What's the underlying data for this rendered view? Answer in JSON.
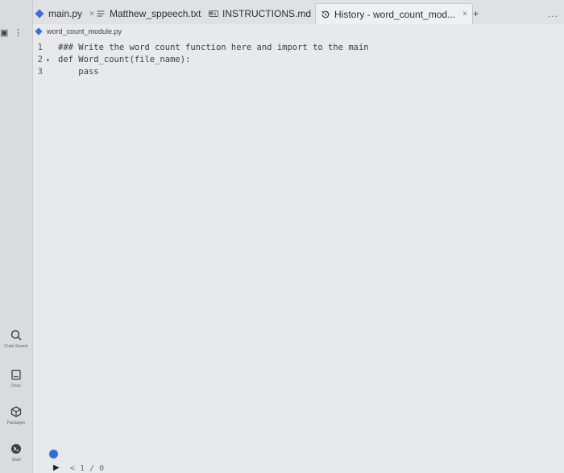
{
  "tabs": [
    {
      "label": "main.py",
      "close": "×",
      "icon": "python-icon"
    },
    {
      "label": "Matthew_sppeech.txt",
      "close": "×",
      "icon": "text-file-icon"
    },
    {
      "label": "INSTRUCTIONS.md",
      "close": "×",
      "icon": "markdown-icon"
    },
    {
      "label": "History - word_count_mod...",
      "close": "×",
      "icon": "history-icon",
      "active": true
    }
  ],
  "tab_add": "+",
  "tab_more": "...",
  "editor": {
    "file_name": "word_count_module.py",
    "lines": [
      {
        "num": "1",
        "fold": "",
        "text": "### Write the word count function here and import to the main"
      },
      {
        "num": "2",
        "fold": "▾",
        "text": "def Word_count(file_name):"
      },
      {
        "num": "3",
        "fold": "",
        "text": "    pass"
      }
    ]
  },
  "sidebar": {
    "tools": [
      {
        "label": "Code Search",
        "icon": "search-icon"
      },
      {
        "label": "Docs",
        "icon": "docs-icon"
      },
      {
        "label": "Packages",
        "icon": "package-icon"
      },
      {
        "label": "Shell",
        "icon": "shell-icon"
      }
    ]
  },
  "bottom": {
    "text": "< 1 / 0"
  },
  "colors": {
    "python": "#3a6fcf",
    "accent": "#2f6fd6"
  }
}
